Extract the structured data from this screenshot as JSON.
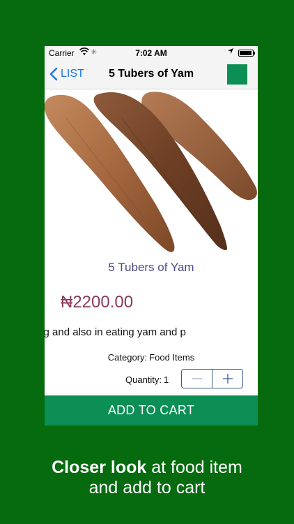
{
  "status_bar": {
    "carrier": "Carrier",
    "time": "7:02 AM"
  },
  "nav": {
    "back_label": "LIST",
    "title": "5 Tubers of Yam"
  },
  "product": {
    "name": "5 Tubers of Yam",
    "price": "₦2200.00",
    "description": "r pounding and also in eating yam and p",
    "category_label": "Category:",
    "category_value": "Food Items",
    "quantity_label": "Quantity:",
    "quantity_value": "1"
  },
  "cart_button_label": "ADD TO CART",
  "caption": {
    "bold": "Closer look",
    "rest_line1": " at food item",
    "line2": "and add to cart"
  },
  "colors": {
    "background": "#056b0e",
    "accent": "#0c8f55",
    "price": "#8c3a5c",
    "title": "#4b4a86",
    "link": "#1a73e8"
  },
  "icons": [
    "wifi-icon",
    "activity-spinner-icon",
    "location-icon",
    "battery-icon",
    "chevron-left-icon",
    "minus-icon",
    "plus-icon"
  ]
}
